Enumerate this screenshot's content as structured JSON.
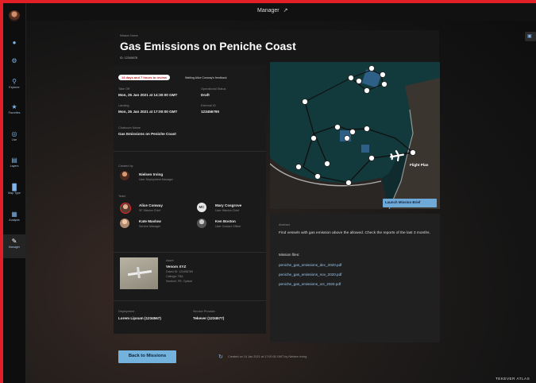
{
  "topbar": {
    "title": "Manager"
  },
  "sidebar": {
    "items": [
      {
        "icon": "bell-icon",
        "glyph": "●",
        "label": ""
      },
      {
        "icon": "gear-icon",
        "glyph": "⚙",
        "label": ""
      },
      {
        "icon": "search-icon",
        "glyph": "⚲",
        "label": "Explorer"
      },
      {
        "icon": "star-icon",
        "glyph": "★",
        "label": "Favorites"
      },
      {
        "icon": "live-icon",
        "glyph": "◎",
        "label": "Live"
      },
      {
        "icon": "layers-icon",
        "glyph": "▤",
        "label": "Layers"
      },
      {
        "icon": "map-type-icon",
        "glyph": "▐▌",
        "label": "Map Type"
      },
      {
        "icon": "analysis-icon",
        "glyph": "▦",
        "label": "Analysis"
      },
      {
        "icon": "pencil-icon",
        "glyph": "✎",
        "label": "Manager"
      }
    ]
  },
  "mission": {
    "kicker": "Mission Name",
    "title": "Gas Emissions on Peniche Coast",
    "id": "ID: 1234567B",
    "review_badge": "14 days and 7 hours to review",
    "feedback_note": "Waiting Alice Conway's feedback",
    "take_off_label": "Take Off",
    "take_off_value": "Mon, 25 Jan 2021 at 14:30:00 GMT",
    "landing_label": "Landing",
    "landing_value": "Mon, 25 Jan 2021 at 17:00:00 GMT",
    "operational_status_label": "Operational Status",
    "operational_status_value": "Draft",
    "external_id_label": "External ID",
    "external_id_value": "123456790",
    "chatroom_label": "Chatroom Name",
    "chatroom_value": "Gas Emissions on Peniche Coast"
  },
  "created_by": {
    "label": "Created by",
    "name": "Nielsen Irving",
    "role": "User Deployment Manager"
  },
  "team": {
    "label": "Team",
    "members": [
      {
        "name": "Alice Conway",
        "role": "SF Mission Chief",
        "initials": ""
      },
      {
        "name": "Mary Cosgrove",
        "role": "User Mission Chief",
        "initials": "MC"
      },
      {
        "name": "Kate Maslow",
        "role": "Service Manager",
        "initials": ""
      },
      {
        "name": "Ken Boston",
        "role": "User Contact Officer",
        "initials": ""
      }
    ]
  },
  "aircraft": {
    "label": "Asset",
    "name": "Venom XYZ",
    "lines": [
      "Dated ID: 123456789",
      "Callsign: TBA",
      "Sentinel, PE: Optical"
    ]
  },
  "deployment": {
    "label": "Deployment",
    "value": "Lorem Lipsum (1234567)"
  },
  "service_provider": {
    "label": "Service Provider",
    "value": "Tekever (1234577)"
  },
  "map": {
    "flight_plan_label": "Flight Plan",
    "launch_button": "Launch Mission Brief"
  },
  "abstract": {
    "label": "Abstract",
    "text": "Find vessels with gas emission above the allowed. Check the reports of the last 3 months.",
    "files_label": "Mission files:",
    "files": [
      "peniche_gas_emissions_dec_2020.pdf",
      "peniche_gas_emissions_nov_2020.pdf",
      "peniche_gas_emissions_oct_2020.pdf"
    ]
  },
  "footer": {
    "back_button": "Back to Missions",
    "created_note": "Created on 14 Jan 2021 at 17:00:00 GMT by Nielsen Irving",
    "brand": "TEKEVER ATLAS"
  }
}
